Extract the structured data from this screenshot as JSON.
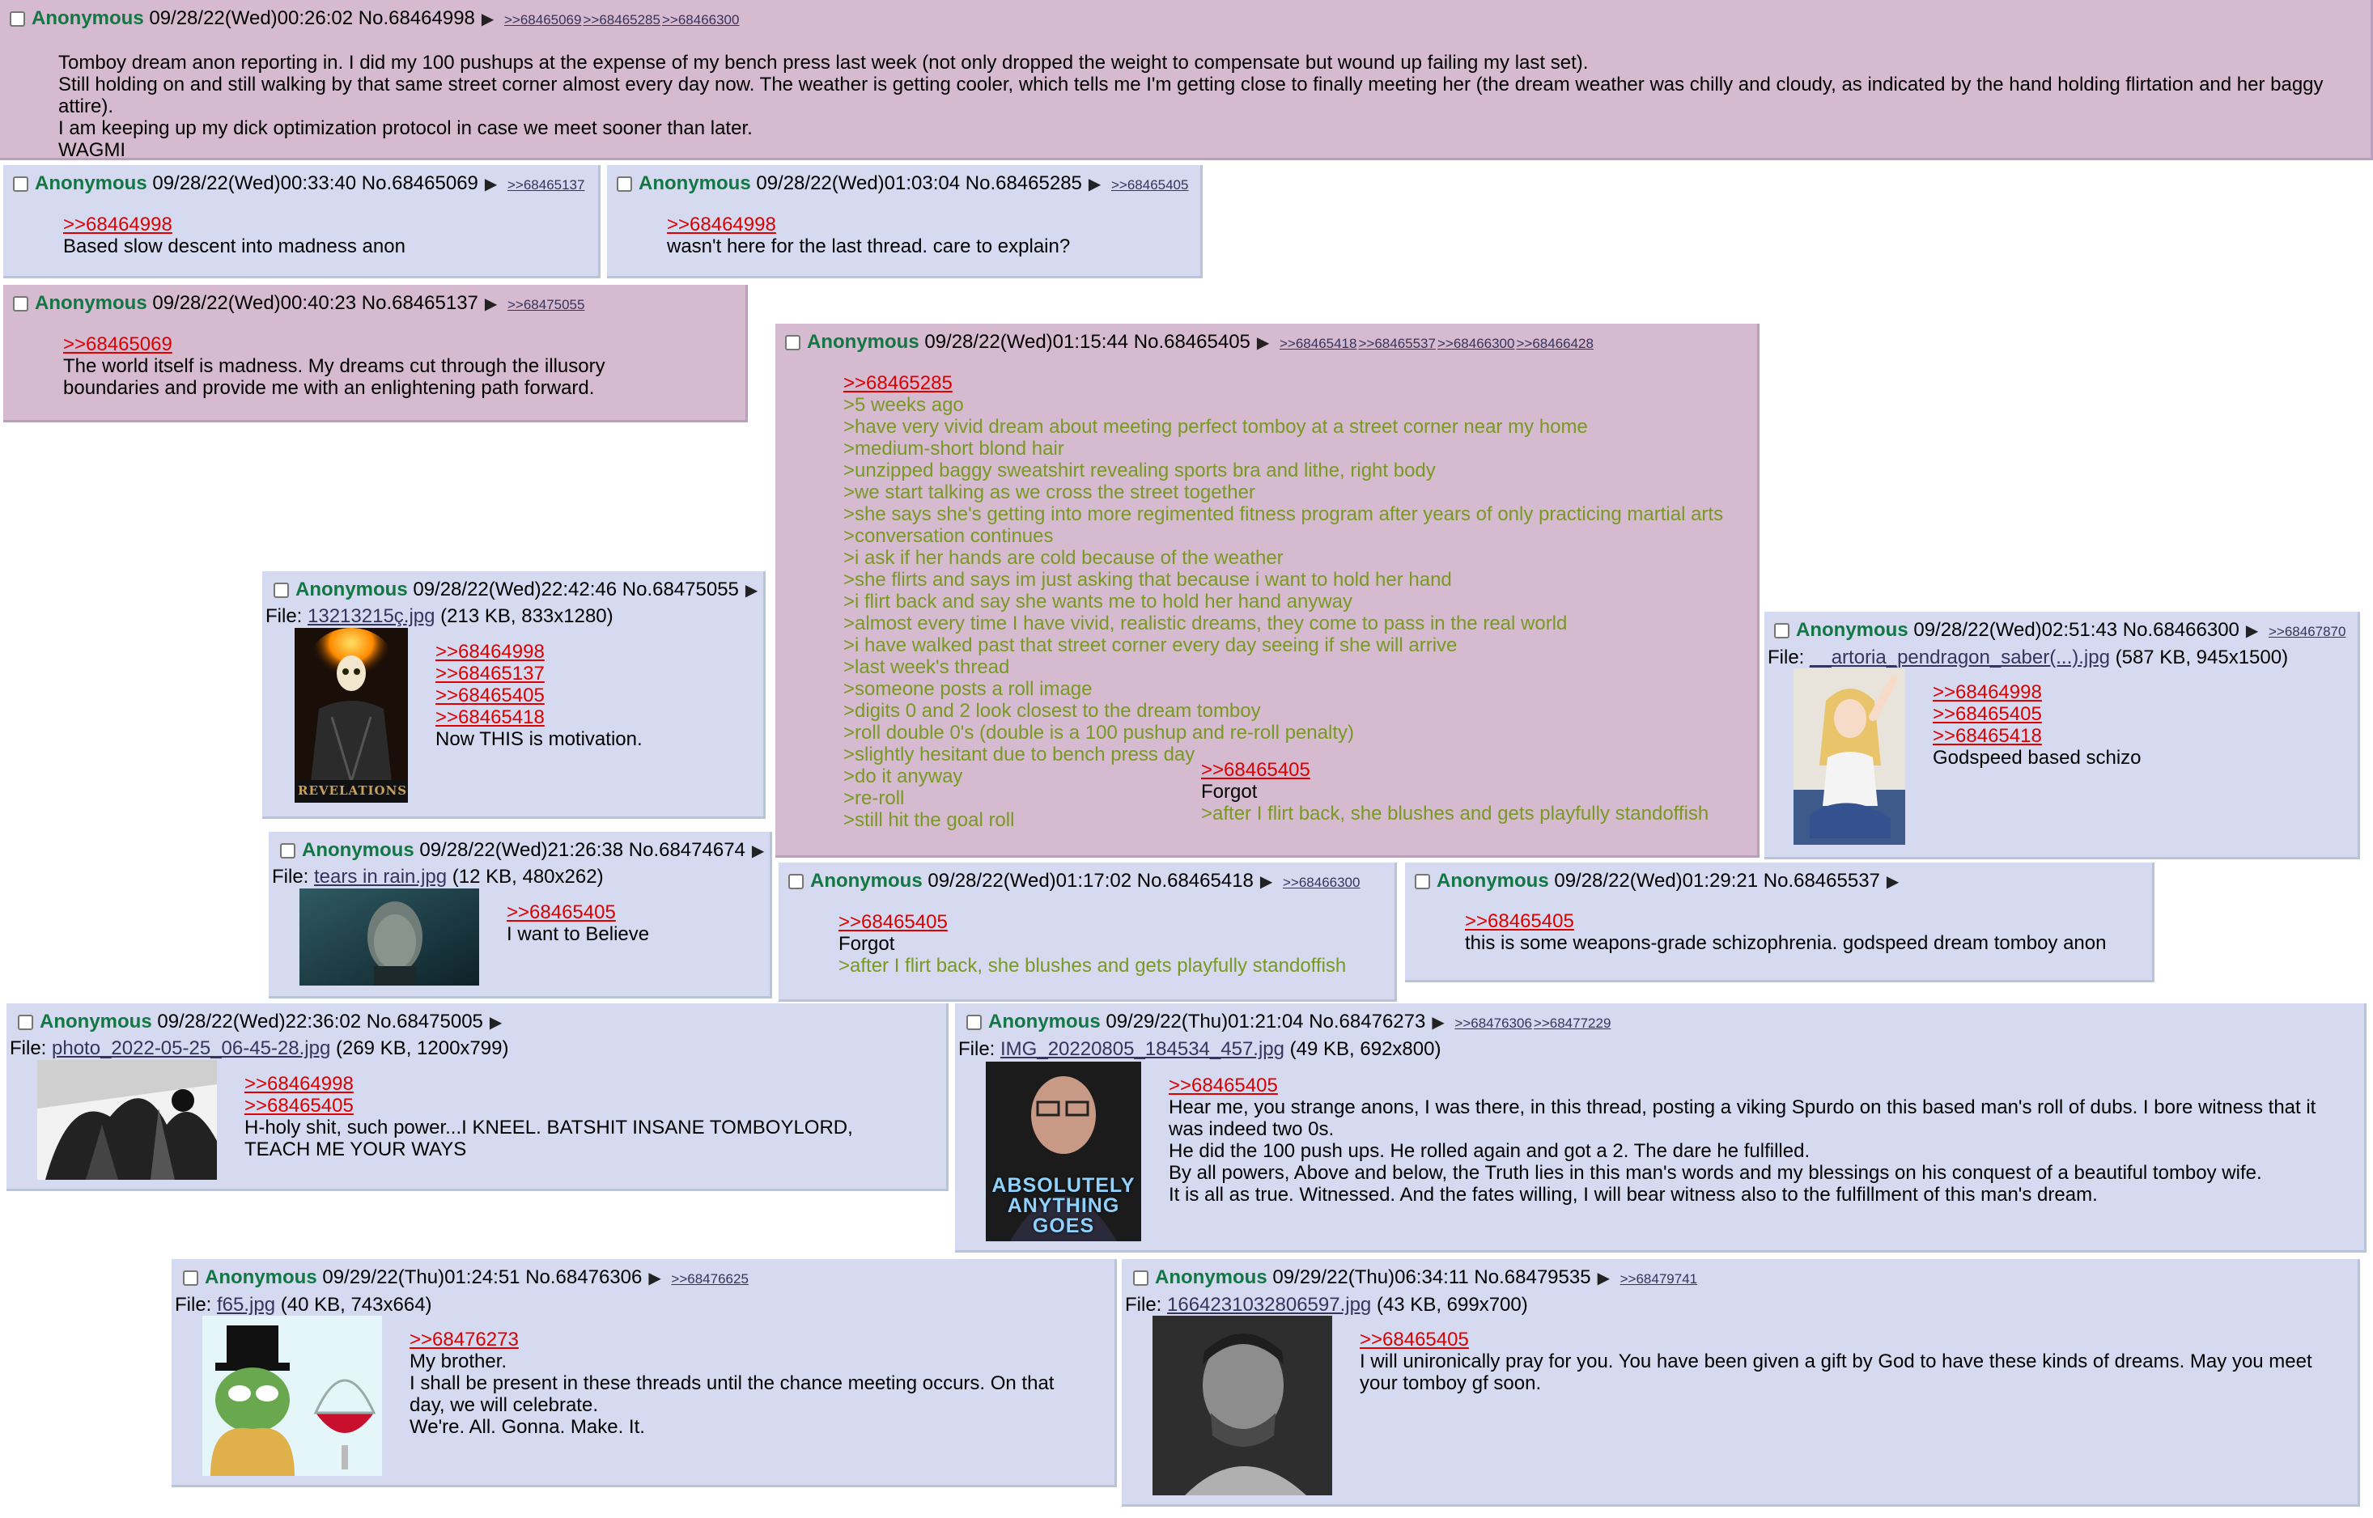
{
  "p1": {
    "name": "Anonymous",
    "datetime": "09/28/22(Wed)00:26:02",
    "no": "No.68464998",
    "backlinks": [
      ">>68465069",
      ">>68465285",
      ">>68466300"
    ],
    "lines": [
      "Tomboy dream anon reporting in. I did my 100 pushups at the expense of my bench press last week (not only dropped the weight to compensate but wound up failing my last set).",
      "Still holding on and still walking by that same street corner almost every day now. The weather is getting cooler, which tells me I'm getting close to finally meeting her (the dream weather was chilly and cloudy, as indicated by the hand holding flirtation and her baggy attire).",
      "I am keeping up my dick optimization protocol in case we meet sooner than later.",
      "WAGMI"
    ]
  },
  "p2": {
    "name": "Anonymous",
    "datetime": "09/28/22(Wed)00:33:40",
    "no": "No.68465069",
    "backlinks": [
      ">>68465137"
    ],
    "quote": ">>68464998",
    "text": "Based slow descent into madness anon"
  },
  "p3": {
    "name": "Anonymous",
    "datetime": "09/28/22(Wed)01:03:04",
    "no": "No.68465285",
    "backlinks": [
      ">>68465405"
    ],
    "quote": ">>68464998",
    "text": "wasn't here for the last thread. care to explain?"
  },
  "p4": {
    "name": "Anonymous",
    "datetime": "09/28/22(Wed)00:40:23",
    "no": "No.68465137",
    "backlinks": [
      ">>68475055"
    ],
    "quote": ">>68465069",
    "lines": [
      "The world itself is madness. My dreams cut through the illusory",
      "boundaries and provide me with an enlightening path forward."
    ]
  },
  "p5": {
    "name": "Anonymous",
    "datetime": "09/28/22(Wed)01:15:44",
    "no": "No.68465405",
    "backlinks": [
      ">>68465418",
      ">>68465537",
      ">>68466300",
      ">>68466428"
    ],
    "quote": ">>68465285",
    "greentext": [
      ">5 weeks ago",
      ">have very vivid dream about meeting perfect tomboy at a street corner near my home",
      ">medium-short blond hair",
      ">unzipped baggy sweatshirt revealing sports bra and lithe, right body",
      ">we start talking as we cross the street together",
      ">she says she's getting into more regimented fitness program after years of only practicing martial arts",
      ">conversation continues",
      ">i ask if her hands are cold because of the weather",
      ">she flirts and says im just asking that because i want to hold her hand",
      ">i flirt back and say she wants me to hold her hand anyway",
      ">almost every time I have vivid, realistic dreams, they come to pass in the real world",
      ">i have walked past that street corner every day seeing if she will arrive",
      ">last week's thread",
      ">someone posts a roll image",
      ">digits 0 and 2 look closest to the dream tomboy",
      ">roll double 0's (double is a 100 pushup and re-roll penalty)",
      ">slightly hesitant due to bench press day",
      ">do it anyway",
      ">re-roll",
      ">still hit the goal roll"
    ],
    "overlay_quote": ">>68465405",
    "overlay_text": "Forgot",
    "overlay_green": ">after I flirt back, she blushes and gets playfully standoffish"
  },
  "p6": {
    "name": "Anonymous",
    "datetime": "09/28/22(Wed)22:42:46",
    "no": "No.68475055",
    "file_label": "File: ",
    "file_name": "13213215ç.jpg",
    "file_meta": " (213 KB, 833x1280)",
    "quotes": [
      ">>68464998",
      ">>68465137",
      ">>68465405",
      ">>68465418"
    ],
    "text": "Now THIS is motivation.",
    "image_caption": "REVELATIONS"
  },
  "p7": {
    "name": "Anonymous",
    "datetime": "09/28/22(Wed)02:51:43",
    "no": "No.68466300",
    "backlinks": [
      ">>68467870"
    ],
    "file_label": "File: ",
    "file_name": "__artoria_pendragon_saber(...).jpg",
    "file_meta": " (587 KB, 945x1500)",
    "quotes": [
      ">>68464998",
      ">>68465405",
      ">>68465418"
    ],
    "text": "Godspeed based schizo"
  },
  "p8": {
    "name": "Anonymous",
    "datetime": "09/28/22(Wed)21:26:38",
    "no": "No.68474674",
    "file_label": "File: ",
    "file_name": "tears in rain.jpg",
    "file_meta": " (12 KB, 480x262)",
    "quote": ">>68465405",
    "text": "I want to Believe"
  },
  "p9": {
    "name": "Anonymous",
    "datetime": "09/28/22(Wed)01:17:02",
    "no": "No.68465418",
    "backlinks": [
      ">>68466300"
    ],
    "quote": ">>68465405",
    "text": "Forgot",
    "green": ">after I flirt back, she blushes and gets playfully standoffish"
  },
  "p10": {
    "name": "Anonymous",
    "datetime": "09/28/22(Wed)01:29:21",
    "no": "No.68465537",
    "quote": ">>68465405",
    "text": "this is some weapons-grade schizophrenia. godspeed dream tomboy anon"
  },
  "p11": {
    "name": "Anonymous",
    "datetime": "09/28/22(Wed)22:36:02",
    "no": "No.68475005",
    "file_label": "File: ",
    "file_name": "photo_2022-05-25_06-45-28.jpg",
    "file_meta": " (269 KB, 1200x799)",
    "quotes": [
      ">>68464998",
      ">>68465405"
    ],
    "lines": [
      "H-holy shit, such power...I KNEEL. BATSHIT INSANE TOMBOYLORD,",
      "TEACH ME YOUR WAYS"
    ]
  },
  "p12": {
    "name": "Anonymous",
    "datetime": "09/29/22(Thu)01:21:04",
    "no": "No.68476273",
    "backlinks": [
      ">>68476306",
      ">>68477229"
    ],
    "file_label": "File: ",
    "file_name": "IMG_20220805_184534_457.jpg",
    "file_meta": " (49 KB, 692x800)",
    "quote": ">>68465405",
    "lines": [
      "Hear me, you strange anons, I was there, in this thread, posting a viking Spurdo on this based man's roll of dubs. I bore witness that it",
      "was indeed two 0s.",
      "He did the 100 push ups. He rolled again and got a 2. The dare he fulfilled.",
      "By all powers, Above and below, the Truth lies in this man's words and my blessings on his conquest of a beautiful tomboy wife.",
      "It is all as true. Witnessed. And the fates willing, I will bear witness also to the fulfillment of this man's dream."
    ],
    "image_caption_1": "ABSOLUTELY",
    "image_caption_2": "ANYTHING GOES"
  },
  "p13": {
    "name": "Anonymous",
    "datetime": "09/29/22(Thu)01:24:51",
    "no": "No.68476306",
    "backlinks": [
      ">>68476625"
    ],
    "file_label": "File: ",
    "file_name": "f65.jpg",
    "file_meta": " (40 KB, 743x664)",
    "quote": ">>68476273",
    "lines": [
      "My brother.",
      "I shall be present in these threads until the chance meeting occurs. On that",
      "day, we will celebrate.",
      "We're. All. Gonna. Make. It."
    ]
  },
  "p14": {
    "name": "Anonymous",
    "datetime": "09/29/22(Thu)06:34:11",
    "no": "No.68479535",
    "backlinks": [
      ">>68479741"
    ],
    "file_label": "File: ",
    "file_name": "1664231032806597.jpg",
    "file_meta": " (43 KB, 699x700)",
    "quote": ">>68465405",
    "lines": [
      "I will unironically pray for you. You have been given a gift by God to have these kinds of dreams. May you meet",
      "your tomboy gf soon."
    ]
  },
  "icons": {
    "checkbox": "checkbox-icon",
    "menu": "triangle-menu-icon"
  },
  "colors": {
    "post_bg": "#d6daf0",
    "highlight_bg": "#d6bad0",
    "name": "#117743",
    "quotelink": "#dd0000",
    "greentext": "#789922",
    "link": "#34345c"
  }
}
